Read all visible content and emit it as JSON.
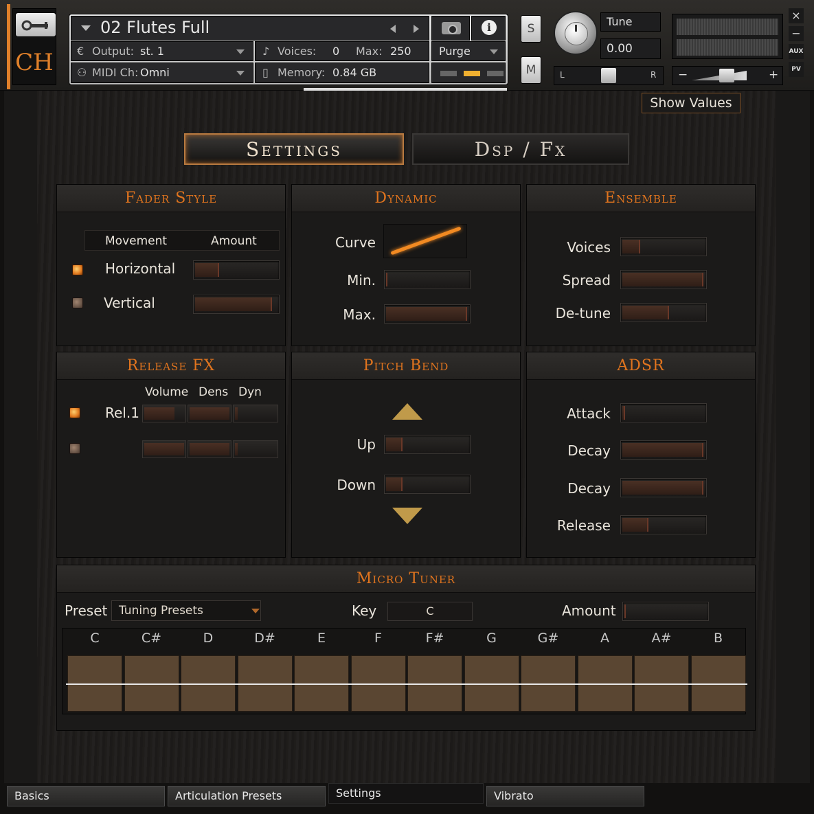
{
  "header": {
    "instrument_name": "02 Flutes Full",
    "logo_text": "CH",
    "output_label": "Output:",
    "output_value": "st. 1",
    "midi_label": "MIDI Ch:",
    "midi_value": "Omni",
    "voices_label": "Voices:",
    "voices_value": "0",
    "max_label": "Max:",
    "max_value": "250",
    "memory_label": "Memory:",
    "memory_value": "0.84 GB",
    "purge_label": "Purge",
    "solo_label": "S",
    "mute_label": "M",
    "tune_label": "Tune",
    "tune_value": "0.00",
    "pan_left": "L",
    "pan_right": "R",
    "vol_minus": "−",
    "vol_plus": "+",
    "close_label": "×",
    "minimize_label": "−",
    "aux_label": "AUX",
    "pv_label": "PV",
    "icons": {
      "wrench": "wrench-icon",
      "camera": "camera-icon",
      "info": "info-icon",
      "output": "output-icon",
      "midi": "midi-icon",
      "voices": "voices-icon",
      "memory": "memory-icon"
    },
    "info_glyph": "i"
  },
  "show_values_label": "Show Values",
  "tabs": {
    "settings": "Settings",
    "dspfx": "Dsp / Fx"
  },
  "fader_style": {
    "title": "Fader Style",
    "col_movement": "Movement",
    "col_amount": "Amount",
    "rows": [
      {
        "label": "Horizontal",
        "enabled": true,
        "amount": 0.3
      },
      {
        "label": "Vertical",
        "enabled": false,
        "amount": 0.95
      }
    ]
  },
  "dynamic": {
    "title": "Dynamic",
    "curve_label": "Curve",
    "min_label": "Min.",
    "min_value": 0.0,
    "max_label": "Max.",
    "max_value": 1.0
  },
  "ensemble": {
    "title": "Ensemble",
    "voices_label": "Voices",
    "voices_value": 0.22,
    "spread_label": "Spread",
    "spread_value": 1.0,
    "detune_label": "De-tune",
    "detune_value": 0.58
  },
  "release_fx": {
    "title": "Release FX",
    "col_volume": "Volume",
    "col_dens": "Dens",
    "col_dyn": "Dyn",
    "rows": [
      {
        "label": "Rel.1",
        "enabled": true
      },
      {
        "label": "",
        "enabled": false
      }
    ]
  },
  "pitch_bend": {
    "title": "Pitch Bend",
    "up_label": "Up",
    "up_value": 0.2,
    "down_label": "Down",
    "down_value": 0.2
  },
  "adsr": {
    "title": "ADSR",
    "attack_label": "Attack",
    "attack_value": 0.03,
    "decay_label": "Decay",
    "decay_value": 1.0,
    "decay2_label": "Decay",
    "decay2_value": 1.0,
    "release_label": "Release",
    "release_value": 0.32
  },
  "micro_tuner": {
    "title": "Micro Tuner",
    "preset_label": "Preset",
    "preset_value": "Tuning Presets",
    "key_label": "Key",
    "key_value": "C",
    "amount_label": "Amount",
    "notes": [
      "C",
      "C#",
      "D",
      "D#",
      "E",
      "F",
      "F#",
      "G",
      "G#",
      "A",
      "A#",
      "B"
    ]
  },
  "bottom_tabs": [
    {
      "label": "Basics",
      "active": false
    },
    {
      "label": "Articulation Presets",
      "active": false
    },
    {
      "label": "Settings",
      "active": true
    },
    {
      "label": "Vibrato",
      "active": false
    }
  ],
  "colors": {
    "accent": "#e0741e",
    "panel_bg": "#1b1a19",
    "text": "#e9e4db",
    "note_cell": "#5a4632"
  }
}
